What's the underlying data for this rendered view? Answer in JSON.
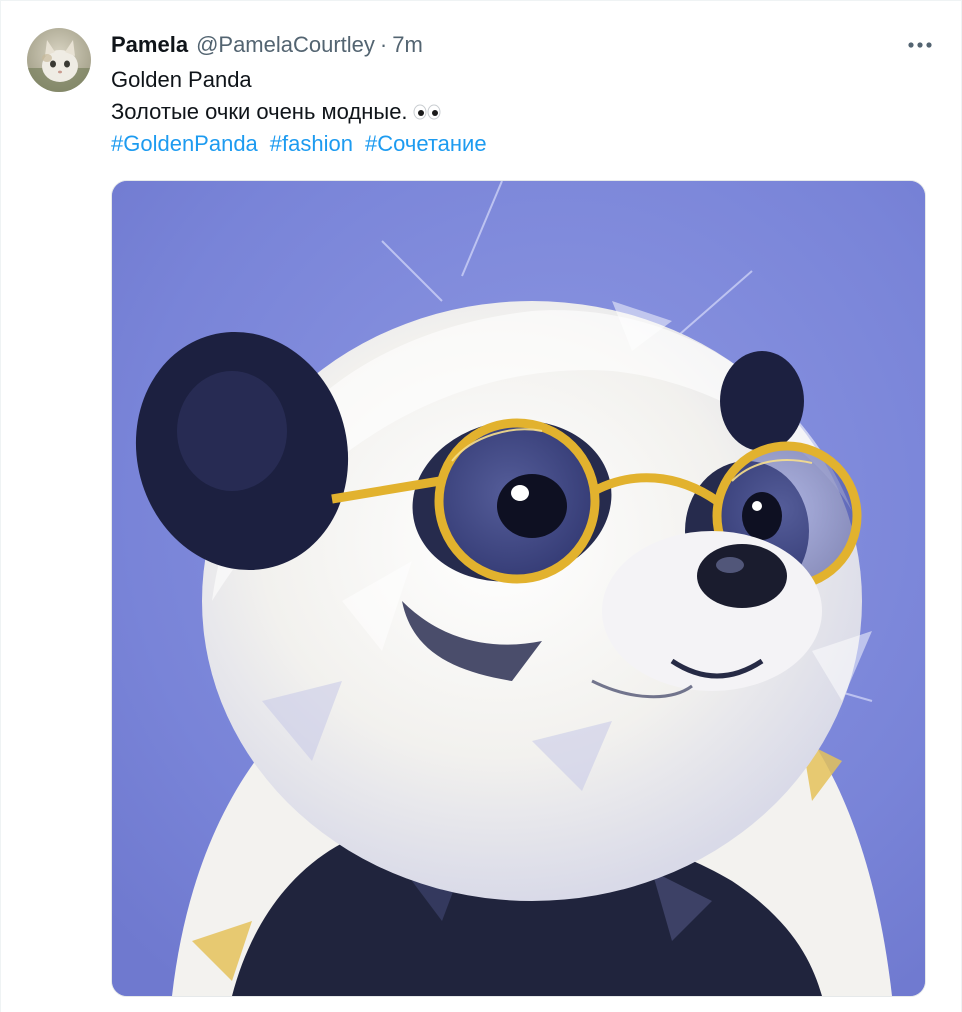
{
  "tweet": {
    "author_name": "Pamela",
    "author_handle": "@PamelaCourtley",
    "separator": "·",
    "time_ago": "7m",
    "text_line1": "Golden Panda",
    "text_line2": "Золотые очки очень модные.",
    "emoji": "eyes",
    "hashtags": [
      "#GoldenPanda",
      "#fashion",
      "#Сочетание"
    ]
  },
  "icons": {
    "more": "more-horizontal-icon",
    "avatar": "kitten-avatar"
  },
  "colors": {
    "link": "#1d9bf0",
    "secondary_text": "#536471",
    "image_background": "#7f8ad9",
    "glasses_gold": "#e2b22e"
  }
}
